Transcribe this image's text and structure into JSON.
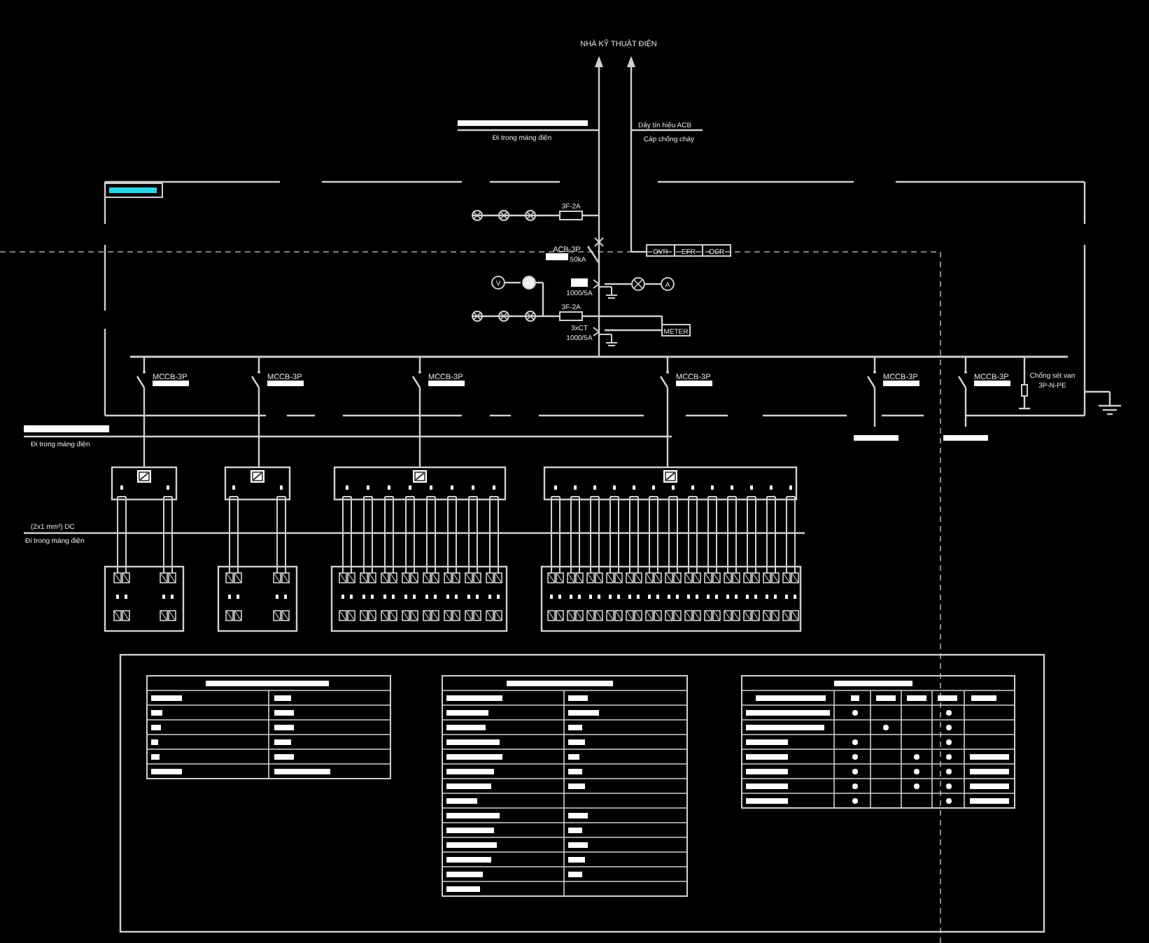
{
  "incoming": {
    "heading": "NHÀ KỸ THUẬT ĐIỆN",
    "tray_note": "Đi trong máng điện",
    "signal_note": "Dây tín hiệu ACB",
    "cable_note": "Cáp chống cháy"
  },
  "main_panel": {
    "fuses": [
      "3F-2A",
      "3F-2A"
    ],
    "breaker": "ACB-3P",
    "breaker_rating": "50kA",
    "ct_ratings": [
      "1000/5A",
      "1000/5A"
    ],
    "ct_label": "3xCT",
    "relays": [
      "OVR",
      "EFR",
      "OCR"
    ],
    "meter": "METER",
    "voltmeter": "V",
    "ammeter": "A"
  },
  "feeders": [
    {
      "label": "MCCB-3P"
    },
    {
      "label": "MCCB-3P"
    },
    {
      "label": "MCCB-3P"
    },
    {
      "label": "MCCB-3P"
    },
    {
      "label": "MCCB-3P"
    },
    {
      "label": "MCCB-3P"
    }
  ],
  "surge_arrester": {
    "label": "Chống sét van",
    "poles": "3P-N-PE"
  },
  "field_wiring": {
    "tray_note": "Đi trong máng điện",
    "cable_label": "(2x1 mm²) DC",
    "cable_tray_note": "Đi trong máng điện"
  }
}
